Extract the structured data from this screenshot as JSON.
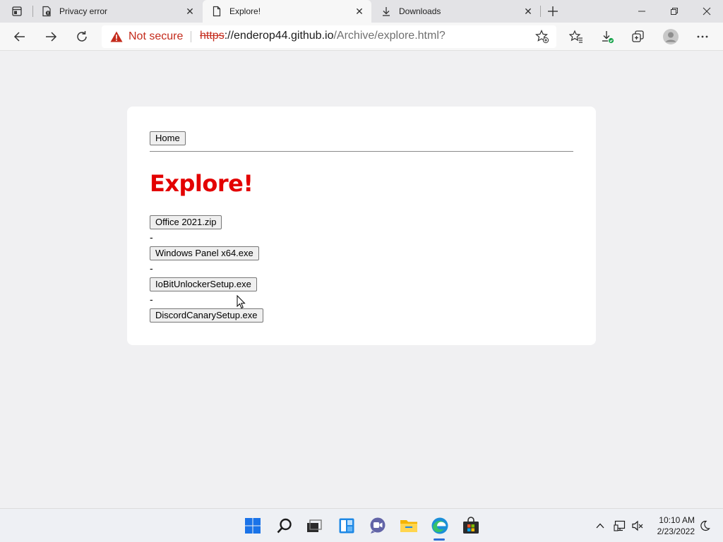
{
  "browser": {
    "tabs": [
      {
        "title": "Privacy error",
        "icon": "privacy-error-icon",
        "active": false
      },
      {
        "title": "Explore!",
        "icon": "page-icon",
        "active": true
      },
      {
        "title": "Downloads",
        "icon": "download-icon",
        "active": false
      }
    ],
    "address_bar": {
      "security_label": "Not secure",
      "url_scheme": "https",
      "url_host": "://enderop44.github.io",
      "url_path": "/Archive/explore.html?"
    }
  },
  "page": {
    "nav": {
      "home_label": "Home"
    },
    "title": "Explore!",
    "separator": "-",
    "files": [
      {
        "label": "Office 2021.zip"
      },
      {
        "label": "Windows Panel x64.exe"
      },
      {
        "label": "IoBitUnlockerSetup.exe"
      },
      {
        "label": "DiscordCanarySetup.exe"
      }
    ]
  },
  "taskbar": {
    "apps": [
      "start-icon",
      "search-icon",
      "task-view-icon",
      "widgets-icon",
      "chat-icon",
      "file-explorer-icon",
      "edge-icon",
      "store-icon"
    ],
    "clock": {
      "time": "10:10 AM",
      "date": "2/23/2022"
    }
  },
  "colors": {
    "accent_red": "#e30000",
    "warning_red": "#c42b1c",
    "edge_blue": "#2d6fd6"
  }
}
